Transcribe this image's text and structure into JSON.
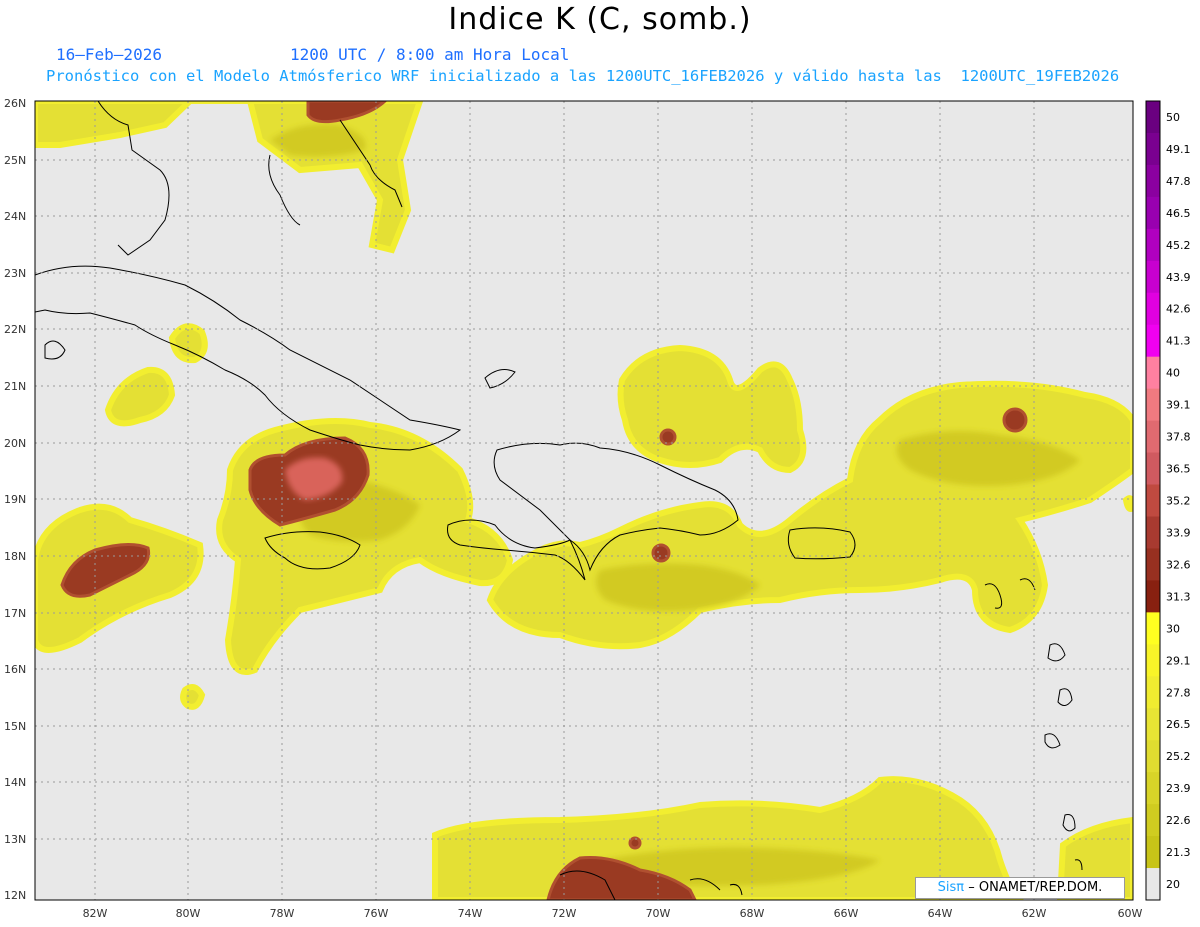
{
  "header": {
    "title": "Indice K (C, somb.)",
    "date": "16–Feb–2026",
    "time": "1200 UTC / 8:00 am Hora Local",
    "model_line": "Pronóstico con el Modelo Atmósferico WRF inicializado a las 1200UTC_16FEB2026 y válido hasta las  1200UTC_19FEB2026"
  },
  "map": {
    "lat_labels": [
      "26N",
      "25N",
      "24N",
      "23N",
      "22N",
      "21N",
      "20N",
      "19N",
      "18N",
      "17N",
      "16N",
      "15N",
      "14N",
      "13N",
      "12N"
    ],
    "lon_labels": [
      "82W",
      "80W",
      "78W",
      "76W",
      "74W",
      "72W",
      "70W",
      "68W",
      "66W",
      "64W",
      "62W",
      "60W"
    ],
    "background_color": "#e8e8e8"
  },
  "colorbar": {
    "labels": [
      "50",
      "49.1",
      "47.8",
      "46.5",
      "45.2",
      "43.9",
      "42.6",
      "41.3",
      "40",
      "39.1",
      "37.8",
      "36.5",
      "35.2",
      "33.9",
      "32.6",
      "31.3",
      "30",
      "29.1",
      "27.8",
      "26.5",
      "25.2",
      "23.9",
      "22.6",
      "21.3",
      "20"
    ],
    "colors": [
      "#6a0080",
      "#7a0090",
      "#8b00a0",
      "#9900b0",
      "#b000c0",
      "#c800d0",
      "#e000e0",
      "#f000f0",
      "#ff80a0",
      "#f07a80",
      "#e06a70",
      "#d05a60",
      "#c04a40",
      "#a83a30",
      "#983020",
      "#882010",
      "#ffff20",
      "#f8f428",
      "#f0ec30",
      "#e8e434",
      "#e0dc30",
      "#d8d428",
      "#d0cc20",
      "#c8c418",
      "#e8e8e8"
    ]
  },
  "credit": {
    "brand": "Sisπ",
    "text": "– ONAMET/REP.DOM."
  }
}
